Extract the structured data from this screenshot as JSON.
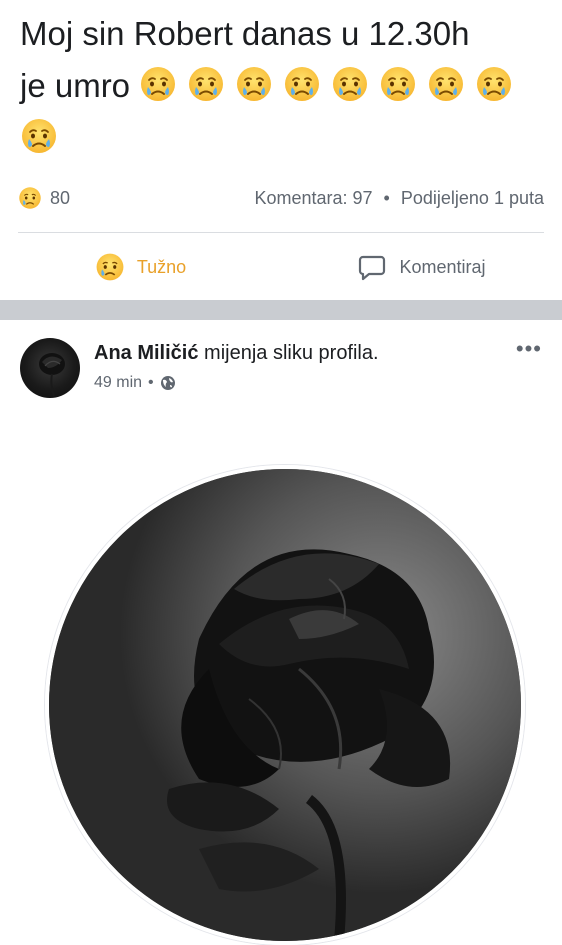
{
  "post": {
    "text_line1": "Moj sin Robert danas u 12.30h",
    "text_line2": "je umro",
    "emoji_icon": "crying-face-icon",
    "emoji_count": 9
  },
  "stats": {
    "reaction_icon": "sad-face-icon",
    "reaction_count": "80",
    "comments": "Komentara: 97",
    "bullet": "•",
    "shares": "Podijeljeno 1 puta"
  },
  "actions": {
    "sad_label": "Tužno",
    "comment_label": "Komentiraj"
  },
  "post2": {
    "author": "Ana Miličić",
    "action_text": "mijenja sliku profila.",
    "time": "49 min",
    "bullet": "•",
    "privacy_icon": "globe-icon",
    "more_icon": "more-options-icon",
    "photo_subject": "black-rose-photo"
  },
  "colors": {
    "sad_accent": "#e9a12a",
    "muted_text": "#606770",
    "separator": "#c9ccd1"
  }
}
